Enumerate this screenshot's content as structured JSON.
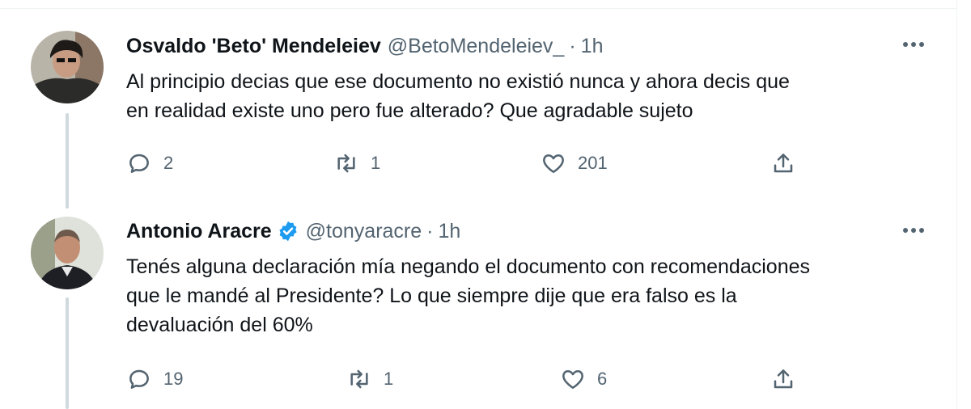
{
  "tweets": [
    {
      "name": "Osvaldo 'Beto' Mendeleiev",
      "handle": "@BetoMendeleiev_",
      "separator": "·",
      "time": "1h",
      "verified": false,
      "text_lines": [
        "Al principio decias que ese documento no existió nunca y ahora decis que",
        "en realidad existe uno pero fue alterado? Que agradable sujeto"
      ],
      "replies": "2",
      "retweets": "1",
      "likes": "201"
    },
    {
      "name": "Antonio Aracre",
      "handle": "@tonyaracre",
      "separator": "·",
      "time": "1h",
      "verified": true,
      "text_lines": [
        "Tenés alguna declaración mía negando el documento con recomendaciones",
        "que le mandé al Presidente? Lo que siempre dije que era falso es la",
        "devaluación del 60%"
      ],
      "replies": "19",
      "retweets": "1",
      "likes": "6"
    }
  ],
  "icons": {
    "reply": "reply-icon",
    "retweet": "retweet-icon",
    "like": "heart-icon",
    "share": "share-icon",
    "more": "more-icon",
    "verified": "verified-badge-icon"
  },
  "colors": {
    "text": "#0f1419",
    "secondary": "#536471",
    "verified": "#1d9bf0",
    "thread_line": "#cfd9de"
  }
}
